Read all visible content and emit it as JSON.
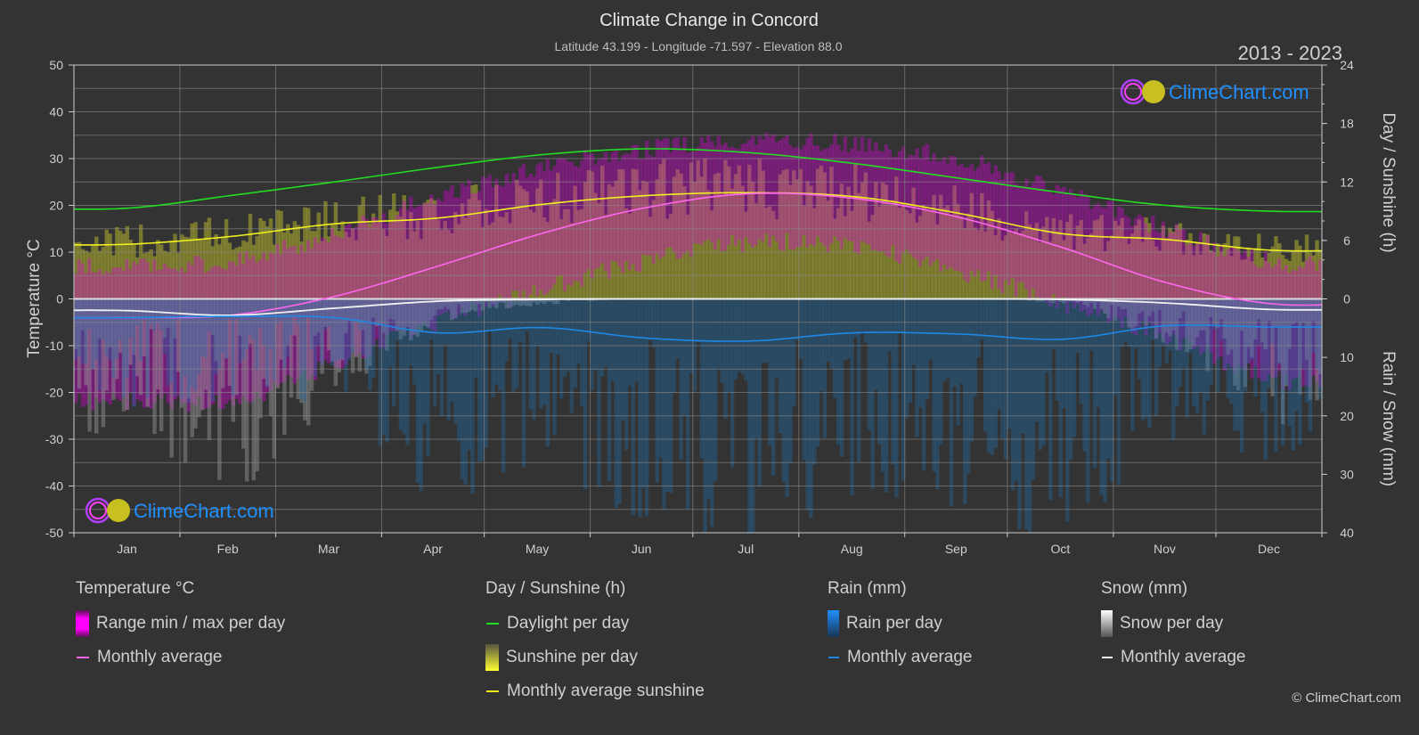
{
  "header": {
    "title": "Climate Change in Concord",
    "subtitle": "Latitude 43.199 - Longitude -71.597 - Elevation 88.0",
    "period": "2013 - 2023"
  },
  "brand": {
    "name": "ClimeChart.com",
    "copyright": "© ClimeChart.com"
  },
  "legend": {
    "temperature": {
      "title": "Temperature °C",
      "items": [
        "Range min / max per day",
        "Monthly average"
      ]
    },
    "sunshine": {
      "title": "Day / Sunshine (h)",
      "items": [
        "Daylight per day",
        "Sunshine per day",
        "Monthly average sunshine"
      ]
    },
    "rain": {
      "title": "Rain (mm)",
      "items": [
        "Rain per day",
        "Monthly average"
      ]
    },
    "snow": {
      "title": "Snow (mm)",
      "items": [
        "Snow per day",
        "Monthly average"
      ]
    }
  },
  "colors": {
    "background": "#333333",
    "temp_avg": "#ff66ee",
    "temp_range": "#e000e0",
    "daylight": "#22dd22",
    "sunshine_avg": "#f0f020",
    "sunshine_fill": "#9c9c30",
    "rain_avg": "#1e88e5",
    "rain_fill": "#1e6fb0",
    "snow_avg": "#f0f0f0",
    "snow_fill": "#9a9a9a"
  },
  "chart_data": {
    "type": "line",
    "title": "Climate Change in Concord",
    "subtitle": "Latitude 43.199 - Longitude -71.597 - Elevation 88.0",
    "period": "2013 - 2023",
    "categories": [
      "Jan",
      "Feb",
      "Mar",
      "Apr",
      "May",
      "Jun",
      "Jul",
      "Aug",
      "Sep",
      "Oct",
      "Nov",
      "Dec"
    ],
    "axes": {
      "left": {
        "label": "Temperature °C",
        "range": [
          -50,
          50
        ],
        "ticks": [
          50,
          40,
          30,
          20,
          10,
          0,
          -10,
          -20,
          -30,
          -40,
          -50
        ]
      },
      "right_top": {
        "label": "Day / Sunshine (h)",
        "range": [
          0,
          24
        ],
        "ticks": [
          24,
          18,
          12,
          6,
          0
        ]
      },
      "right_bottom": {
        "label": "Rain / Snow (mm)",
        "range": [
          0,
          40
        ],
        "ticks": [
          0,
          10,
          20,
          30,
          40
        ]
      }
    },
    "grid": true,
    "series": [
      {
        "name": "Temperature monthly average",
        "axis": "left",
        "unit": "°C",
        "values": [
          -4.0,
          -3.5,
          0.5,
          7.0,
          14.0,
          19.5,
          22.5,
          21.5,
          17.5,
          11.0,
          3.5,
          -1.0
        ]
      },
      {
        "name": "Temperature daily range (approx. min)",
        "axis": "left",
        "unit": "°C",
        "values": [
          -20,
          -20,
          -12,
          -3,
          4,
          10,
          14,
          13,
          8,
          1,
          -6,
          -15
        ]
      },
      {
        "name": "Temperature daily range (approx. max)",
        "axis": "left",
        "unit": "°C",
        "values": [
          5,
          6,
          12,
          20,
          26,
          30,
          32,
          31,
          28,
          21,
          13,
          6
        ]
      },
      {
        "name": "Daylight per day",
        "axis": "right_top",
        "unit": "h",
        "values": [
          9.3,
          10.6,
          12.0,
          13.5,
          14.8,
          15.4,
          15.0,
          13.9,
          12.4,
          10.9,
          9.6,
          9.0
        ]
      },
      {
        "name": "Monthly average sunshine",
        "axis": "right_top",
        "unit": "h",
        "values": [
          5.6,
          6.4,
          7.7,
          8.3,
          9.7,
          10.6,
          10.9,
          10.5,
          8.8,
          6.7,
          6.1,
          5.0
        ]
      },
      {
        "name": "Rain monthly average",
        "axis": "right_bottom",
        "unit": "mm",
        "values": [
          3.2,
          3.0,
          3.2,
          5.8,
          4.9,
          6.7,
          7.2,
          5.8,
          6.0,
          6.9,
          4.6,
          4.8
        ]
      },
      {
        "name": "Snow monthly average",
        "axis": "right_bottom",
        "unit": "mm",
        "values": [
          2.0,
          2.8,
          1.6,
          0.4,
          0.1,
          0.0,
          0.0,
          0.0,
          0.0,
          0.1,
          0.7,
          1.8
        ]
      }
    ],
    "legend_position": "bottom"
  }
}
